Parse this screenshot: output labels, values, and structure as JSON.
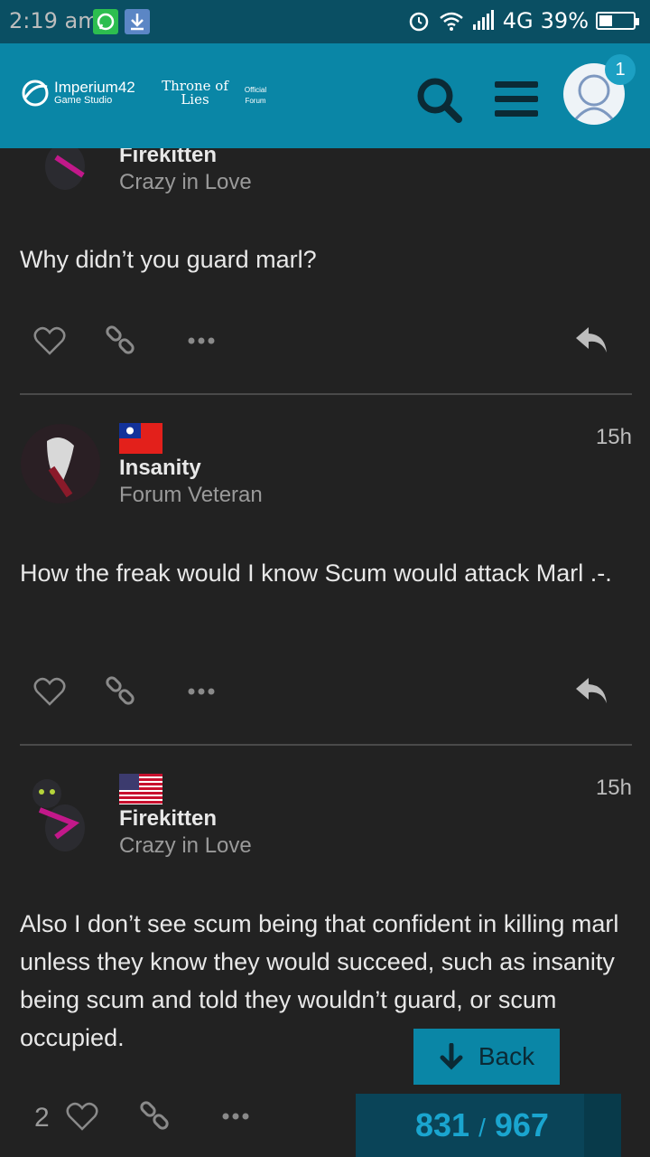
{
  "status_bar": {
    "time": "2:19 am",
    "network": "4G",
    "battery": "39%",
    "battery_level": 0.39
  },
  "header": {
    "logo_primary": "Imperium42",
    "logo_primary_sub": "Game Studio",
    "logo_secondary": "Throne of Lies",
    "logo_tertiary": "Official Forum",
    "notification_count": "1"
  },
  "posts": [
    {
      "username": "Firekitten",
      "title": "Crazy in Love",
      "body": "Why didn’t you guard marl?"
    },
    {
      "username": "Insanity",
      "title": "Forum Veteran",
      "time": "15h",
      "body": "How the freak would I know Scum would attack Marl .-."
    },
    {
      "username": "Firekitten",
      "title": "Crazy in Love",
      "time": "15h",
      "body": "Also I don’t see scum being that confident in killing marl unless they know they would succeed, such as insanity being scum and told they wouldn’t guard, or scum occupied.",
      "likes": "2"
    }
  ],
  "back_button": {
    "label": "Back"
  },
  "progress": {
    "current": "831",
    "total": "967"
  },
  "colors": {
    "accent": "#0a86a6",
    "background": "#222222",
    "status_bar": "#0a4f63"
  }
}
